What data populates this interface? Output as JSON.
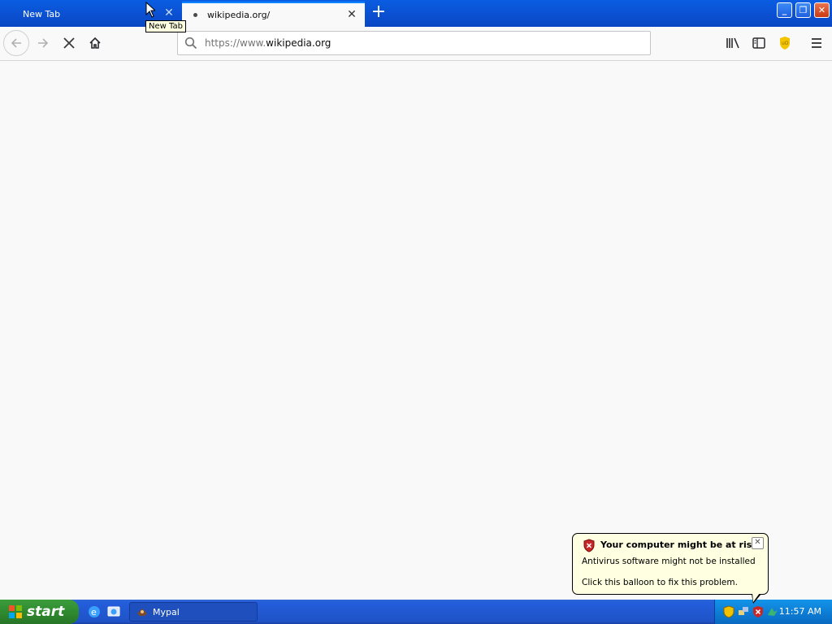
{
  "browser": {
    "tabs": [
      {
        "label": "New Tab",
        "active": false
      },
      {
        "label": "wikipedia.org/",
        "active": true
      }
    ],
    "new_tab_symbol": "+",
    "tab_close_symbol": "✕",
    "tooltip": "New Tab",
    "url": {
      "prefix": "https://www.",
      "host": "wikipedia.org"
    },
    "window_buttons": {
      "minimize": "_",
      "maximize": "❐",
      "close": "✕"
    }
  },
  "balloon": {
    "title": "Your computer might be at risk",
    "line1": "Antivirus software might not be installed",
    "line2": "Click this balloon to fix this problem.",
    "close_symbol": "✕"
  },
  "taskbar": {
    "start_label": "start",
    "task_label": "Mypal",
    "clock": "11:57 AM"
  },
  "colors": {
    "accent": "#0a84ff",
    "xp_blue": "#245edb",
    "xp_green": "#2f8a2f",
    "balloon_bg": "#ffffe1"
  },
  "icons": [
    "back-arrow-icon",
    "forward-arrow-icon",
    "stop-icon",
    "home-icon",
    "search-icon",
    "library-icon",
    "sidebar-icon",
    "ublock-icon",
    "hamburger-menu-icon",
    "shield-icon",
    "windows-flag-icon",
    "ie-icon",
    "mypal-icon",
    "security-center-icon",
    "network-icon"
  ]
}
